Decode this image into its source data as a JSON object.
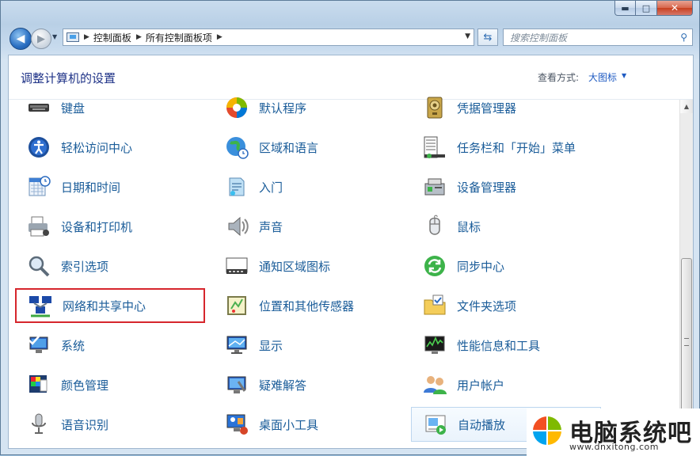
{
  "window": {
    "caption_buttons": {
      "minimize": "▬",
      "maximize": "□",
      "close": "✕"
    }
  },
  "toolbar": {
    "back_icon": "arrow-left-icon",
    "forward_icon": "arrow-right-icon",
    "breadcrumb": [
      "控制面板",
      "所有控制面板项"
    ],
    "search_placeholder": "搜索控制面板"
  },
  "header": {
    "title": "调整计算机的设置",
    "view_label": "查看方式:",
    "view_value": "大图标"
  },
  "items": [
    [
      {
        "label": "键盘",
        "icon": "keyboard-icon"
      },
      {
        "label": "轻松访问中心",
        "icon": "ease-of-access-icon"
      },
      {
        "label": "日期和时间",
        "icon": "calendar-clock-icon"
      },
      {
        "label": "设备和打印机",
        "icon": "printer-icon"
      },
      {
        "label": "索引选项",
        "icon": "magnifier-icon"
      },
      {
        "label": "网络和共享中心",
        "icon": "network-icon",
        "highlighted": true
      },
      {
        "label": "系统",
        "icon": "computer-check-icon"
      },
      {
        "label": "颜色管理",
        "icon": "color-management-icon"
      },
      {
        "label": "语音识别",
        "icon": "microphone-icon"
      }
    ],
    [
      {
        "label": "默认程序",
        "icon": "default-programs-icon"
      },
      {
        "label": "区域和语言",
        "icon": "globe-clock-icon"
      },
      {
        "label": "入门",
        "icon": "getting-started-icon"
      },
      {
        "label": "声音",
        "icon": "speaker-icon"
      },
      {
        "label": "通知区域图标",
        "icon": "taskbar-tray-icon"
      },
      {
        "label": "位置和其他传感器",
        "icon": "sensor-icon"
      },
      {
        "label": "显示",
        "icon": "monitor-icon"
      },
      {
        "label": "疑难解答",
        "icon": "troubleshoot-icon"
      },
      {
        "label": "桌面小工具",
        "icon": "gadgets-icon"
      }
    ],
    [
      {
        "label": "凭据管理器",
        "icon": "credential-vault-icon"
      },
      {
        "label": "任务栏和「开始」菜单",
        "icon": "taskbar-start-icon"
      },
      {
        "label": "设备管理器",
        "icon": "device-manager-icon"
      },
      {
        "label": "鼠标",
        "icon": "mouse-icon"
      },
      {
        "label": "同步中心",
        "icon": "sync-icon"
      },
      {
        "label": "文件夹选项",
        "icon": "folder-options-icon"
      },
      {
        "label": "性能信息和工具",
        "icon": "performance-icon"
      },
      {
        "label": "用户帐户",
        "icon": "users-icon"
      },
      {
        "label": "自动播放",
        "icon": "autoplay-icon",
        "hovered": true
      }
    ]
  ],
  "watermark": {
    "text": "电脑系统吧",
    "url": "www.dnxitong.com",
    "colors": [
      "#f25022",
      "#7fba00",
      "#00a4ef",
      "#ffb900"
    ]
  }
}
